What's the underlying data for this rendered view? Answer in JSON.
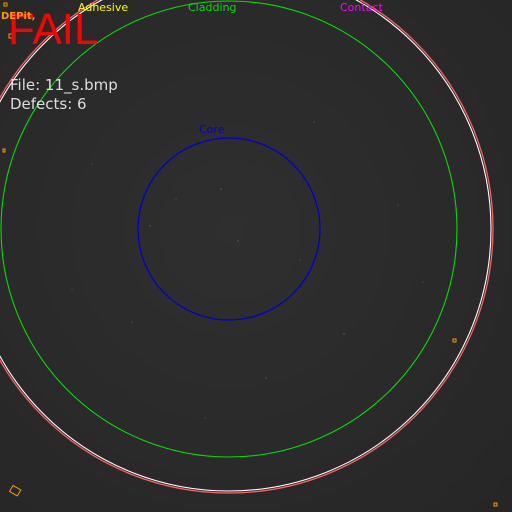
{
  "result": "FAIL",
  "file_info": "File: 11_s.bmp",
  "defect_info": "Defects: 6",
  "defect_tag": "DEPit,",
  "zones": {
    "adhesive": "Adhesive",
    "cladding": "Cladding",
    "contact": "Contact",
    "core": "Core"
  },
  "colors": {
    "fail": "#ff0000",
    "adhesive": "#ffff00",
    "cladding": "#00e000",
    "contact": "#ff00ff",
    "core": "#0000cc",
    "contact_ring_inner": "#ffffff",
    "contact_ring_outer": "#ff6060",
    "defect_marker": "#ff9900",
    "info_text": "#dddddd"
  },
  "icons": {
    "defect_marker": "orange-square-outline"
  }
}
